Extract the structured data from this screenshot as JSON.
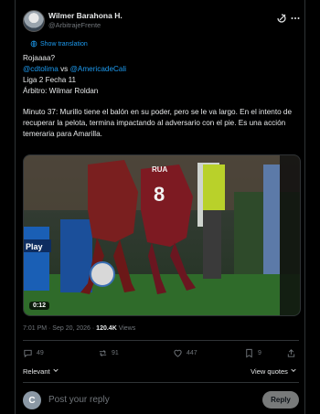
{
  "author": {
    "name": "Wilmer Barahona H.",
    "handle": "@ArbitrajeFrente"
  },
  "icons": {
    "grok": "grok-icon",
    "more": "more-icon",
    "translate": "globe-icon",
    "reply": "reply-icon",
    "repost": "repost-icon",
    "like": "heart-icon",
    "bookmark": "bookmark-icon",
    "share": "share-icon",
    "chevron": "chevron-down-icon"
  },
  "translation_link": "Show translation",
  "post": {
    "line1": "Rojaaaa?",
    "mention1": "@cdtolima",
    "vs": " vs ",
    "mention2": "@AmericadeCali",
    "line3": "Liga 2 Fecha 11",
    "line4": "Árbitro: Wilmar Roldan",
    "body": "Minuto 37: Murillo tiene el balón en su poder, pero se le va largo. En el intento de recuperar la pelota, termina impactando al adversario con el pie. Es una acción temeraria para Amarilla."
  },
  "video": {
    "duration": "0:12",
    "player_number": "8",
    "player_name": "RUA",
    "board_text": "Play"
  },
  "meta": {
    "time": "7:01 PM · Sep 20, 2026 · ",
    "views_count": "120.4K",
    "views_label": " Views"
  },
  "stats": {
    "replies": "49",
    "reposts": "91",
    "likes": "447",
    "bookmarks": "9"
  },
  "relevant_label": "Relevant",
  "view_quotes": "View quotes",
  "reply": {
    "avatar_letter": "C",
    "placeholder": "Post your reply",
    "button": "Reply"
  },
  "colors": {
    "accent": "#1d9bf0",
    "background": "#000000",
    "muted": "#71767b"
  }
}
